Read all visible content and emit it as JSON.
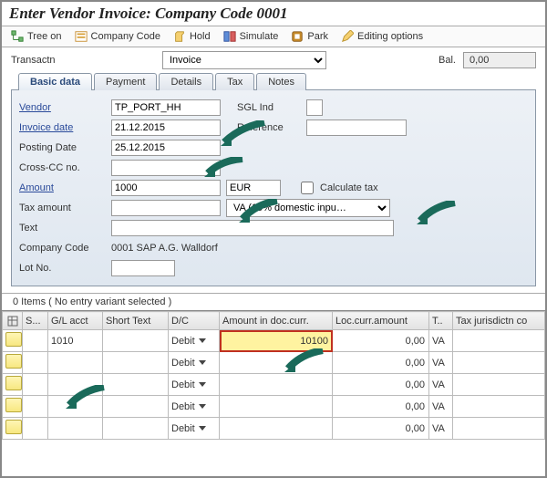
{
  "title": "Enter Vendor Invoice: Company Code 0001",
  "toolbar": {
    "tree_on": "Tree on",
    "company_code": "Company Code",
    "hold": "Hold",
    "simulate": "Simulate",
    "park": "Park",
    "editing_options": "Editing options"
  },
  "transaction": {
    "label": "Transactn",
    "value": "Invoice"
  },
  "balance": {
    "label": "Bal.",
    "value": "0,00"
  },
  "tabs": [
    "Basic data",
    "Payment",
    "Details",
    "Tax",
    "Notes"
  ],
  "basic": {
    "vendor_label": "Vendor",
    "vendor_value": "TP_PORT_HH",
    "sgl_label": "SGL Ind",
    "sgl_value": "",
    "invoice_date_label": "Invoice date",
    "invoice_date_value": "21.12.2015",
    "reference_label": "Reference",
    "reference_value": "",
    "posting_date_label": "Posting Date",
    "posting_date_value": "25.12.2015",
    "crosscc_label": "Cross-CC no.",
    "crosscc_value": "",
    "amount_label": "Amount",
    "amount_value": "1000",
    "currency_value": "EUR",
    "calc_tax_label": "Calculate tax",
    "tax_amount_label": "Tax amount",
    "tax_amount_value": "",
    "tax_code_value": "VA (19% domestic inpu…",
    "text_label": "Text",
    "text_value": "",
    "company_code_label": "Company Code",
    "company_code_value": "0001 SAP A.G. Walldorf",
    "lot_no_label": "Lot No.",
    "lot_no_value": ""
  },
  "grid_title": "0 Items ( No entry variant selected )",
  "grid": {
    "headers": {
      "s": "S...",
      "gl_acct": "G/L acct",
      "short_text": "Short Text",
      "dc": "D/C",
      "amount_doc": "Amount in doc.curr.",
      "loc_amount": "Loc.curr.amount",
      "t": "T..",
      "tax_jur": "Tax jurisdictn co"
    },
    "rows": [
      {
        "gl_acct": "1010",
        "dc": "Debit",
        "amount_doc": "10100",
        "loc_amount": "0,00",
        "t": "VA"
      },
      {
        "gl_acct": "",
        "dc": "Debit",
        "amount_doc": "",
        "loc_amount": "0,00",
        "t": "VA"
      },
      {
        "gl_acct": "",
        "dc": "Debit",
        "amount_doc": "",
        "loc_amount": "0,00",
        "t": "VA"
      },
      {
        "gl_acct": "",
        "dc": "Debit",
        "amount_doc": "",
        "loc_amount": "0,00",
        "t": "VA"
      },
      {
        "gl_acct": "",
        "dc": "Debit",
        "amount_doc": "",
        "loc_amount": "0,00",
        "t": "VA"
      }
    ]
  }
}
